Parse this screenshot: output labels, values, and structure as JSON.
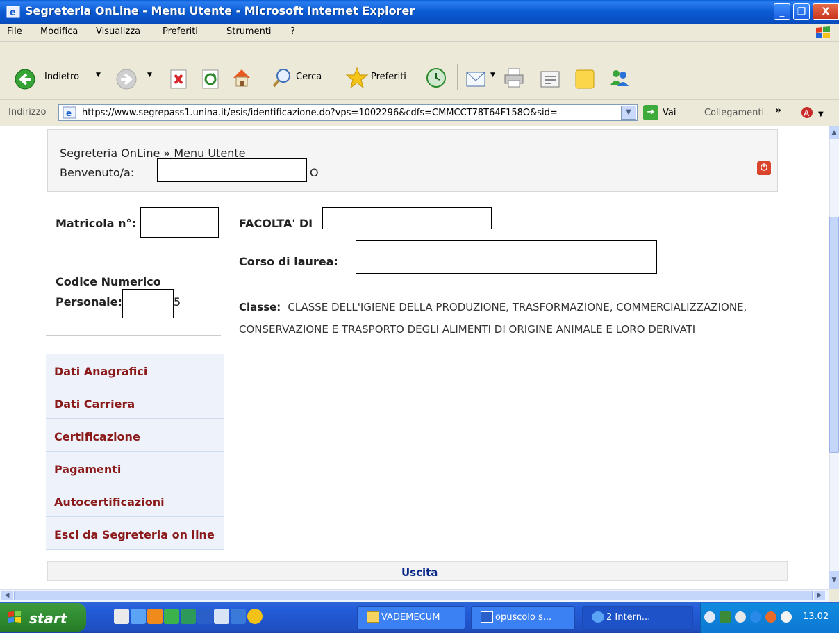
{
  "window": {
    "title": "Segreteria OnLine - Menu Utente - Microsoft Internet Explorer",
    "minimize": "_",
    "maximize": "❐",
    "close": "X"
  },
  "menubar": [
    "File",
    "Modifica",
    "Visualizza",
    "Preferiti",
    "Strumenti",
    "?"
  ],
  "toolbar": {
    "back": "Indietro",
    "search": "Cerca",
    "favorites": "Preferiti"
  },
  "address": {
    "label": "Indirizzo",
    "url": "https://www.segrepass1.unina.it/esis/identificazione.do?vps=1002296&cdfs=CMMCCT78T64F158O&sid=",
    "go": "Vai",
    "links": "Collegamenti"
  },
  "page": {
    "breadcrumb_root": "Segreteria On",
    "breadcrumb_root_link": "Line",
    "breadcrumb_sep": " » ",
    "breadcrumb_current": "Menu Utente",
    "welcome_label": "Benvenuto/a:",
    "welcome_suffix": "O",
    "matricola_label": "Matricola n°:",
    "cnp_label_line1": "Codice Numerico",
    "cnp_label_line2": "Personale:",
    "cnp_suffix": "5",
    "facolta_label": "FACOLTA' DI",
    "corso_label": "Corso di laurea:",
    "classe_label": "Classe:",
    "classe_value": "CLASSE DELL'IGIENE DELLA PRODUZIONE, TRASFORMAZIONE, COMMERCIALIZZAZIONE, CONSERVAZIONE E TRASPORTO DEGLI ALIMENTI DI ORIGINE ANIMALE E LORO DERIVATI",
    "exit_link": "Uscita"
  },
  "sidenav": [
    "Dati Anagrafici",
    "Dati Carriera",
    "Certificazione",
    "Pagamenti",
    "Autocertificazioni",
    "Esci da Segreteria on line"
  ],
  "taskbar": {
    "start": "start",
    "tasks": [
      "VADEMECUM",
      "opuscolo s...",
      "2 Intern..."
    ],
    "clock": "13.02"
  },
  "colors": {
    "nav_text": "#8b1a1a",
    "xp_blue": "#245edb",
    "start_green": "#2f8a2f"
  }
}
